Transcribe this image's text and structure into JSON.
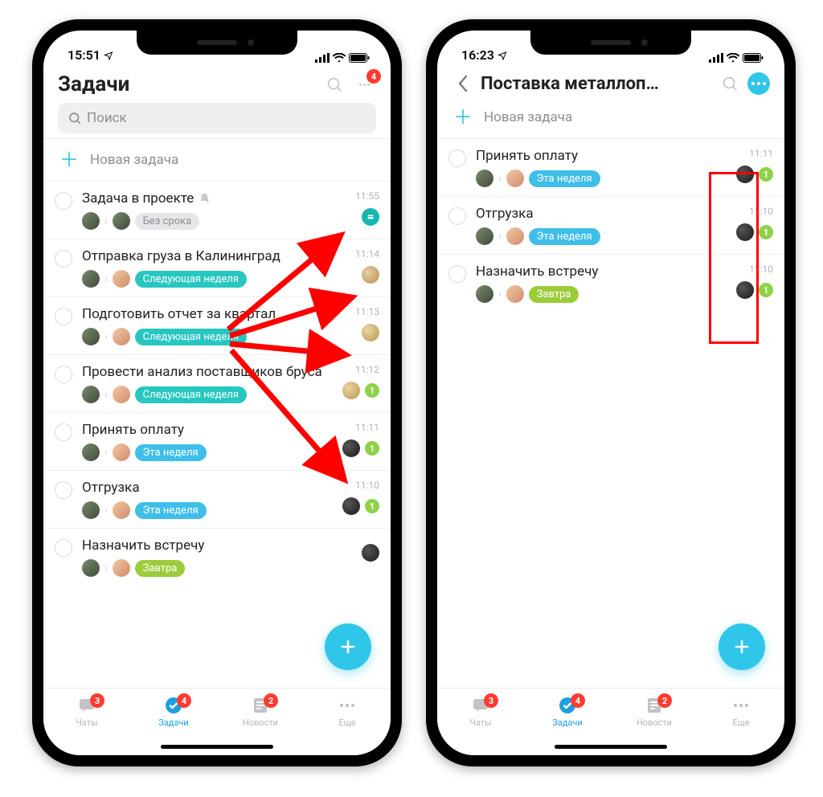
{
  "colors": {
    "accent": "#2fc6e9",
    "badge_red": "#ff3b30",
    "badge_green": "#8fd24a"
  },
  "tag_colors": {
    "no_date": "#e6e6e8",
    "next_week": "#27c7c0",
    "this_week": "#3fbfe8",
    "tomorrow": "#9ccc3c"
  },
  "left": {
    "status_time": "15:51",
    "title": "Задачи",
    "header_badge": "4",
    "search_placeholder": "Поиск",
    "new_task_label": "Новая задача",
    "tasks": [
      {
        "title": "Задача в проекте",
        "muted": true,
        "time": "11:55",
        "tag": "Без срока",
        "tag_kind": "no_date",
        "avatars": [
          "a1",
          "a1"
        ],
        "proj": "teal",
        "count": null
      },
      {
        "title": "Отправка груза в Калининград",
        "muted": false,
        "time": "11:14",
        "tag": "Следующая неделя",
        "tag_kind": "next_week",
        "avatars": [
          "a1",
          "a2"
        ],
        "proj": "sand",
        "count": null
      },
      {
        "title": "Подготовить отчет за квартал",
        "muted": false,
        "time": "11:13",
        "tag": "Следующая неделя",
        "tag_kind": "next_week",
        "avatars": [
          "a1",
          "a2"
        ],
        "proj": "wood",
        "count": null
      },
      {
        "title": "Провести анализ поставщиков бруса",
        "muted": false,
        "time": "11:12",
        "tag": "Следующая неделя",
        "tag_kind": "next_week",
        "avatars": [
          "a1",
          "a2"
        ],
        "proj": "wood",
        "count": "1"
      },
      {
        "title": "Принять оплату",
        "muted": false,
        "time": "11:11",
        "tag": "Эта неделя",
        "tag_kind": "this_week",
        "avatars": [
          "a1",
          "a2"
        ],
        "proj": "dark",
        "count": "1"
      },
      {
        "title": "Отгрузка",
        "muted": false,
        "time": "11:10",
        "tag": "Эта неделя",
        "tag_kind": "this_week",
        "avatars": [
          "a1",
          "a2"
        ],
        "proj": "dark",
        "count": "1"
      },
      {
        "title": "Назначить встречу",
        "muted": false,
        "time": "",
        "tag": "Завтра",
        "tag_kind": "tomorrow",
        "avatars": [
          "a1",
          "a2"
        ],
        "proj": "dark",
        "count": null
      }
    ]
  },
  "right": {
    "status_time": "16:23",
    "title": "Поставка металлоп…",
    "new_task_label": "Новая задача",
    "tasks": [
      {
        "title": "Принять оплату",
        "time": "11:11",
        "tag": "Эта неделя",
        "tag_kind": "this_week",
        "avatars": [
          "a1",
          "a2"
        ],
        "proj": "dark",
        "count": "1"
      },
      {
        "title": "Отгрузка",
        "time": "11:10",
        "tag": "Эта неделя",
        "tag_kind": "this_week",
        "avatars": [
          "a1",
          "a2"
        ],
        "proj": "dark",
        "count": "1"
      },
      {
        "title": "Назначить встречу",
        "time": "11:10",
        "tag": "Завтра",
        "tag_kind": "tomorrow",
        "avatars": [
          "a1",
          "a2"
        ],
        "proj": "dark",
        "count": "1"
      }
    ]
  },
  "tabs": {
    "items": [
      {
        "label": "Чаты",
        "badge": "3",
        "active": false
      },
      {
        "label": "Задачи",
        "badge": "4",
        "active": true
      },
      {
        "label": "Новости",
        "badge": "2",
        "active": false
      },
      {
        "label": "Еще",
        "badge": null,
        "active": false
      }
    ]
  }
}
